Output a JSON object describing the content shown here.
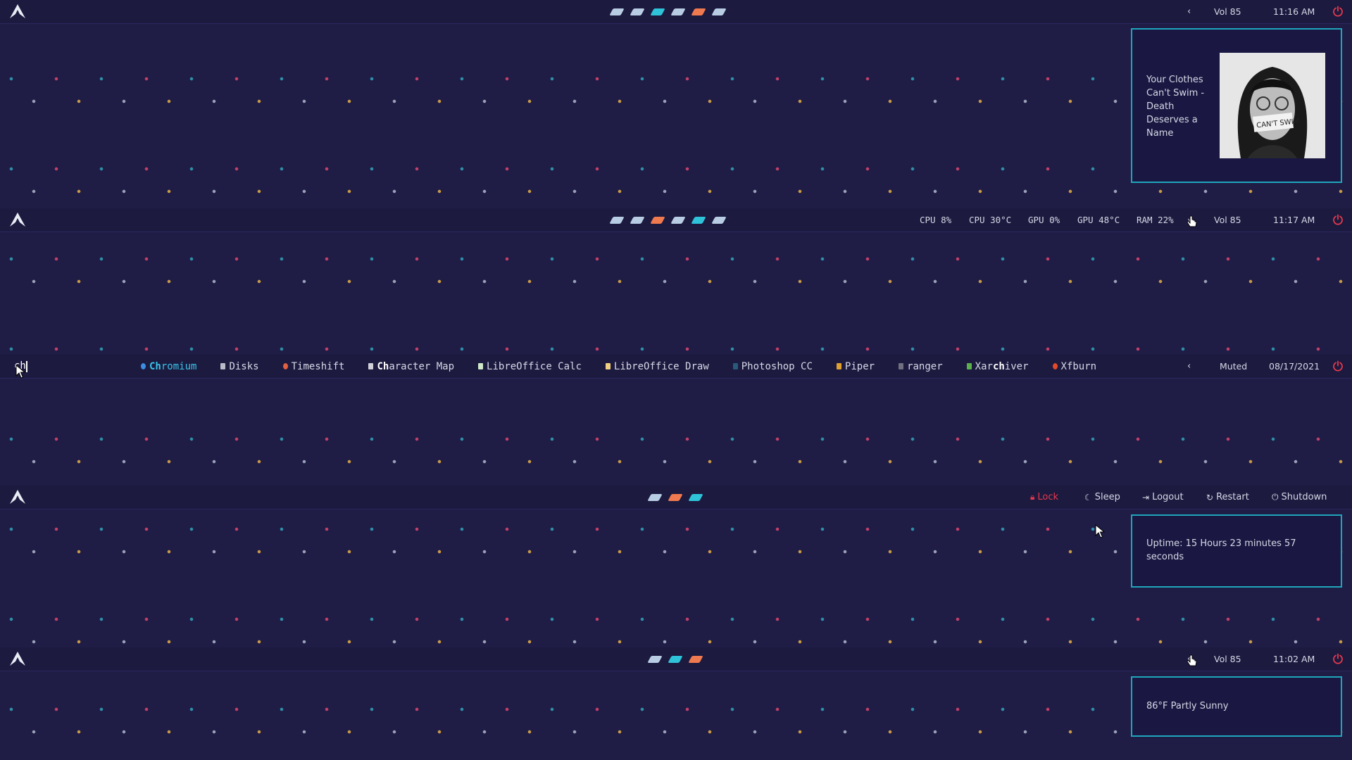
{
  "colors": {
    "background": "#1f1c45",
    "bar": "#1c1a3f",
    "accent": "#1fa6bc",
    "power_red": "#e8394d",
    "ws_teal": "#2ec3d9",
    "ws_orange": "#f07a50",
    "ws_pale": "#b8cde4"
  },
  "bar1": {
    "workspaces": [
      "pale",
      "pale",
      "teal",
      "pale",
      "orange",
      "pale"
    ],
    "volume": "Vol 85",
    "time": "11:16 AM"
  },
  "music_popup": {
    "text": "Your Clothes Can't Swim - Death Deserves a Name",
    "album_art": "album-cover"
  },
  "bar2": {
    "workspaces": [
      "pale",
      "pale",
      "orange",
      "pale",
      "teal",
      "pale"
    ],
    "cpu": "CPU 8%",
    "cpu_temp": "CPU 30°C",
    "gpu": "GPU 0%",
    "gpu_temp": "GPU 48°C",
    "ram": "RAM 22%",
    "volume": "Vol 85",
    "time": "11:17 AM"
  },
  "bar3": {
    "query": "ch",
    "apps": [
      {
        "pre": "",
        "match": "Ch",
        "post": "romium",
        "icon": "chromium-icon",
        "color": "#3a8de0"
      },
      {
        "pre": "Disks",
        "match": "",
        "post": "",
        "icon": "disks-icon",
        "color": "#b8bcc8"
      },
      {
        "pre": "Timeshift",
        "match": "",
        "post": "",
        "icon": "timeshift-icon",
        "color": "#e06040"
      },
      {
        "pre": "",
        "match": "Ch",
        "post": "aracter Map",
        "icon": "charmap-icon",
        "color": "#d0d0d8"
      },
      {
        "pre": "LibreOffice Calc",
        "match": "",
        "post": "",
        "icon": "calc-icon",
        "color": "#cfe8c8"
      },
      {
        "pre": "LibreOffice Draw",
        "match": "",
        "post": "",
        "icon": "draw-icon",
        "color": "#f0d080"
      },
      {
        "pre": "Photoshop CC",
        "match": "",
        "post": "",
        "icon": "photoshop-icon",
        "color": "#2a5a7a"
      },
      {
        "pre": "Piper",
        "match": "",
        "post": "",
        "icon": "piper-icon",
        "color": "#e0a030"
      },
      {
        "pre": "ranger",
        "match": "",
        "post": "",
        "icon": "ranger-icon",
        "color": "#707080"
      },
      {
        "pre": "Xar",
        "match": "ch",
        "post": "iver",
        "icon": "xarchiver-icon",
        "color": "#5ab04a"
      },
      {
        "pre": "Xfburn",
        "match": "",
        "post": "",
        "icon": "xfburn-icon",
        "color": "#e04a2a"
      }
    ],
    "volume": "Muted",
    "date": "08/17/2021"
  },
  "bar4": {
    "workspaces": [
      "pale",
      "orange",
      "teal"
    ],
    "buttons": {
      "lock": "Lock",
      "sleep": "Sleep",
      "logout": "Logout",
      "restart": "Restart",
      "shutdown": "Shutdown"
    }
  },
  "uptime_popup": {
    "text": "Uptime: 15 Hours 23 minutes 57 seconds"
  },
  "bar5": {
    "workspaces": [
      "pale",
      "teal",
      "orange"
    ],
    "volume": "Vol 85",
    "time": "11:02 AM"
  },
  "weather_popup": {
    "text": "86°F Partly Sunny"
  }
}
